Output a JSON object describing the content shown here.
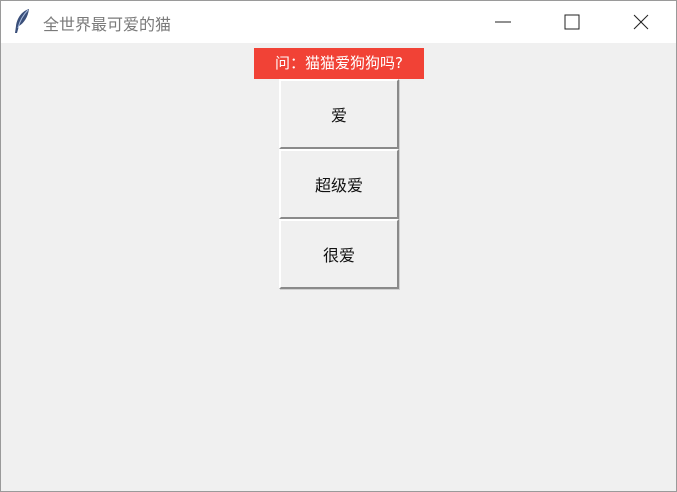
{
  "window": {
    "title": "全世界最可爱的猫",
    "icon": "feather-icon",
    "controls": [
      "minimize-icon",
      "maximize-icon",
      "close-icon"
    ]
  },
  "question": {
    "text": "问：猫猫爱狗狗吗?",
    "bg_color": "#f14236",
    "text_color": "#ffffff"
  },
  "answers": [
    {
      "label": "爱"
    },
    {
      "label": "超级爱"
    },
    {
      "label": "很爱"
    }
  ],
  "colors": {
    "client_bg": "#f0f0f0",
    "titlebar_bg": "#ffffff"
  }
}
